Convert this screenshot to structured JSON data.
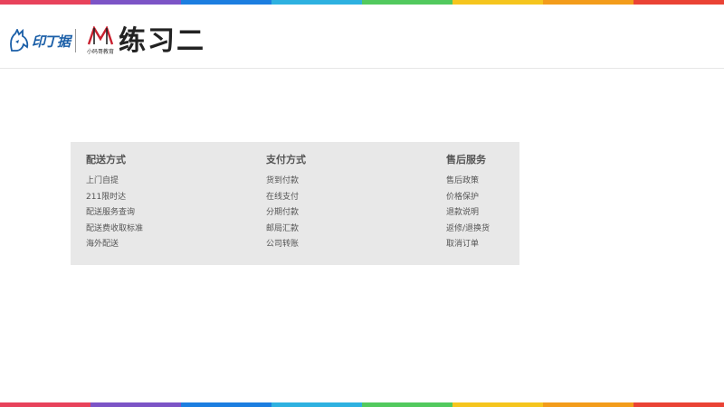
{
  "header": {
    "logo_text": "印丁据",
    "logo2_sub": "小码哥教育",
    "title": "练习二"
  },
  "stripe_colors": [
    "#e8425b",
    "#7c54c6",
    "#1c7ee0",
    "#2eb1e0",
    "#52c95e",
    "#f5c51e",
    "#f39c1b",
    "#ea4335"
  ],
  "footer": {
    "columns": [
      {
        "title": "配送方式",
        "links": [
          "上门自提",
          "211限时达",
          "配送服务查询",
          "配送费收取标准",
          "海外配送"
        ]
      },
      {
        "title": "支付方式",
        "links": [
          "货到付款",
          "在线支付",
          "分期付款",
          "邮局汇款",
          "公司转账"
        ]
      },
      {
        "title": "售后服务",
        "links": [
          "售后政策",
          "价格保护",
          "退款说明",
          "返修/退换货",
          "取消订单"
        ]
      }
    ]
  }
}
